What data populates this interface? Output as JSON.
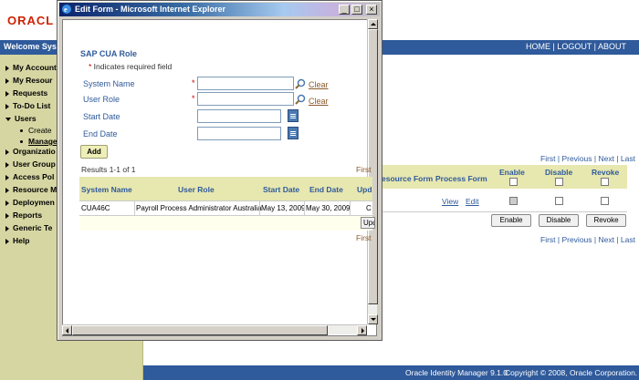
{
  "background": {
    "logo_text": "ORACL",
    "welcome": "Welcome Syste",
    "top_links": "HOME | LOGOUT | ABOUT",
    "nav": [
      {
        "label": "My Account"
      },
      {
        "label": "My Resour"
      },
      {
        "label": "Requests"
      },
      {
        "label": "To-Do List"
      },
      {
        "label": "Users"
      },
      {
        "label": "Organizatio"
      },
      {
        "label": "User Group"
      },
      {
        "label": "Access Pol"
      },
      {
        "label": "Resource M"
      },
      {
        "label": "Deploymen"
      },
      {
        "label": "Reports"
      },
      {
        "label": "Generic Te"
      },
      {
        "label": "Help"
      }
    ],
    "users_sub": [
      {
        "label": "Create"
      },
      {
        "label": "Manage"
      }
    ],
    "pager_top": "First | Previous | Next | Last",
    "pager_bottom": "First | Previous | Next | Last",
    "table": {
      "headers": {
        "resource_form": "esource Form",
        "process_form": "Process Form",
        "enable": "Enable",
        "disable": "Disable",
        "revoke": "Revoke"
      },
      "row": {
        "view": "View",
        "edit": "Edit"
      },
      "buttons": {
        "enable": "Enable",
        "disable": "Disable",
        "revoke": "Revoke"
      }
    },
    "footer": {
      "product": "Oracle Identity Manager 9.1.0",
      "copyright": "Copyright © 2008, Oracle Corporation."
    }
  },
  "popup": {
    "window_title": "Edit Form - Microsoft Internet Explorer",
    "form_title": "SAP CUA Role",
    "required_note": "Indicates required field",
    "fields": {
      "system_name": {
        "label": "System Name",
        "value": ""
      },
      "user_role": {
        "label": "User Role",
        "value": ""
      },
      "start_date": {
        "label": "Start Date",
        "value": ""
      },
      "end_date": {
        "label": "End Date",
        "value": ""
      }
    },
    "clear_label": "Clear",
    "add_label": "Add",
    "results_info": "Results 1-1 of 1",
    "first_label": "First",
    "table": {
      "headers": {
        "system_name": "System Name",
        "user_role": "User Role",
        "start_date": "Start Date",
        "end_date": "End Date",
        "update": "Upd"
      },
      "rows": [
        {
          "system_name": "CUA46C",
          "user_role": "Payroll Process Administrator Australia",
          "start_date": "May 13, 2009",
          "end_date": "May 30, 2009",
          "update": "C"
        }
      ],
      "update_button": "Upd"
    }
  }
}
